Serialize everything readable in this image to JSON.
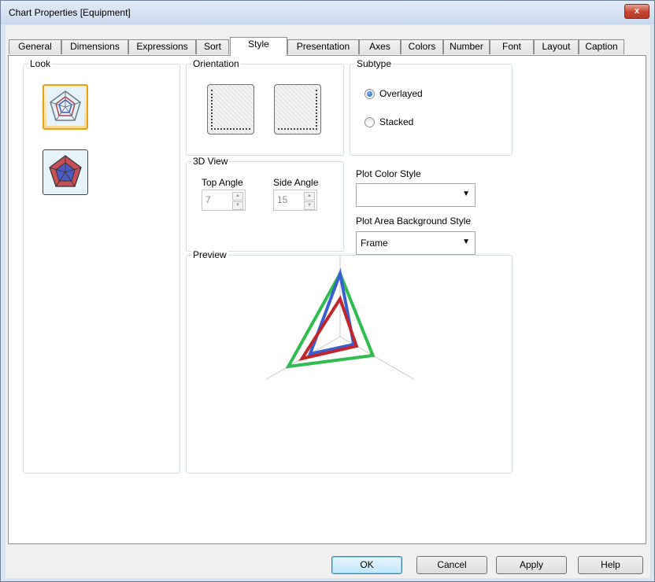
{
  "window": {
    "title": "Chart Properties [Equipment]",
    "close_glyph": "x"
  },
  "tabs": [
    {
      "label": "General"
    },
    {
      "label": "Dimensions"
    },
    {
      "label": "Expressions"
    },
    {
      "label": "Sort"
    },
    {
      "label": "Style"
    },
    {
      "label": "Presentation"
    },
    {
      "label": "Axes"
    },
    {
      "label": "Colors"
    },
    {
      "label": "Number"
    },
    {
      "label": "Font"
    },
    {
      "label": "Layout"
    },
    {
      "label": "Caption"
    }
  ],
  "active_tab": "Style",
  "look": {
    "legend": "Look",
    "options": [
      "radar-line-icon",
      "radar-filled-icon"
    ],
    "selected": 0
  },
  "orientation": {
    "legend": "Orientation",
    "options": [
      "vertical-orientation-icon",
      "horizontal-orientation-icon"
    ]
  },
  "subtype": {
    "legend": "Subtype",
    "options": [
      {
        "label": "Overlayed",
        "checked": true
      },
      {
        "label": "Stacked",
        "checked": false
      }
    ]
  },
  "view3d": {
    "legend": "3D View",
    "top_angle_label": "Top Angle",
    "top_angle_value": "7",
    "side_angle_label": "Side Angle",
    "side_angle_value": "15"
  },
  "plot_color_style": {
    "label": "Plot Color Style",
    "value": ""
  },
  "plot_area_bg_style": {
    "label": "Plot Area Background Style",
    "value": "Frame"
  },
  "preview": {
    "legend": "Preview"
  },
  "chart_data": {
    "type": "radar",
    "axes": 3,
    "series": [
      {
        "color": "#3a5fd0",
        "values": [
          1.0,
          0.55,
          0.25
        ]
      },
      {
        "color": "#2ebd4e",
        "values": [
          1.0,
          0.95,
          0.6
        ]
      },
      {
        "color": "#c0272d",
        "values": [
          0.6,
          0.7,
          0.3
        ]
      }
    ]
  },
  "buttons": {
    "ok": "OK",
    "cancel": "Cancel",
    "apply": "Apply",
    "help": "Help"
  }
}
